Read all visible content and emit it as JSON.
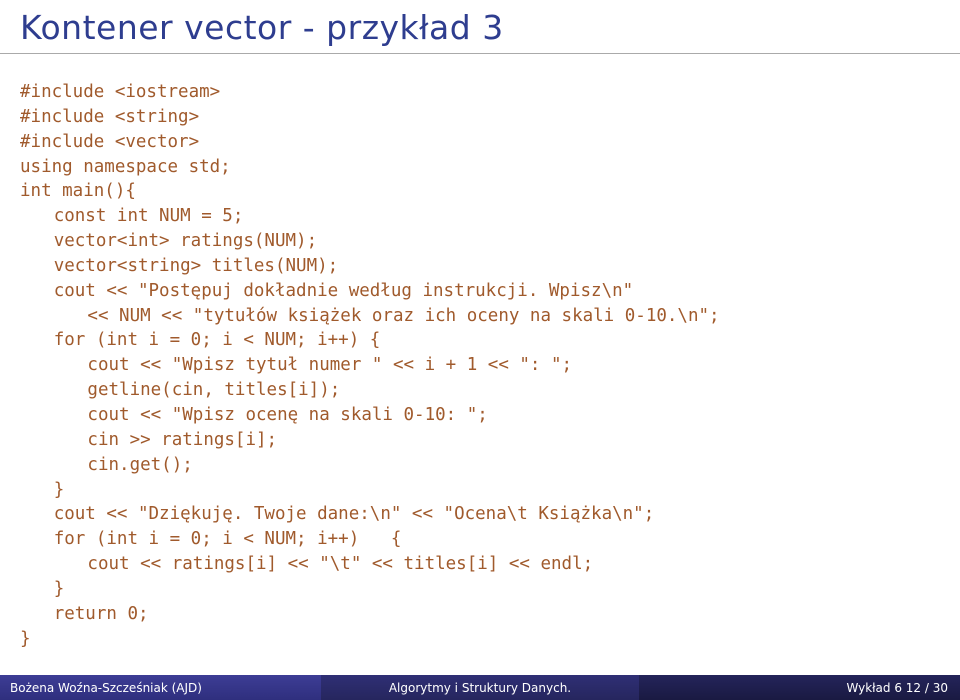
{
  "title": "Kontener vector - przykład 3",
  "code": {
    "l01": "#include <iostream>",
    "l02": "#include <string>",
    "l03": "#include <vector>",
    "l04": "using namespace std;",
    "l05": "int main(){",
    "l06": "const int NUM = 5;",
    "l07": "vector<int> ratings(NUM);",
    "l08": "vector<string> titles(NUM);",
    "l09": "cout << \"Postępuj dokładnie według instrukcji. Wpisz\\n\"",
    "l10": "<< NUM << \"tytułów książek oraz ich oceny na skali 0-10.\\n\";",
    "l11": "for (int i = 0; i < NUM; i++) {",
    "l12": "cout << \"Wpisz tytuł numer \" << i + 1 << \": \";",
    "l13": "getline(cin, titles[i]);",
    "l14": "cout << \"Wpisz ocenę na skali 0-10: \";",
    "l15": "cin >> ratings[i];",
    "l16": "cin.get();",
    "l17": "}",
    "l18": "cout << \"Dziękuję. Twoje dane:\\n\" << \"Ocena\\t Książka\\n\";",
    "l19": "for (int i = 0; i < NUM; i++)   {",
    "l20": "cout << ratings[i] << \"\\t\" << titles[i] << endl;",
    "l21": "}",
    "l22": "return 0;",
    "l23": "}"
  },
  "footer": {
    "author": "Bożena Woźna-Szcześniak (AJD)",
    "course": "Algorytmy i Struktury Danych.",
    "page": "Wykład 6    12 / 30"
  }
}
